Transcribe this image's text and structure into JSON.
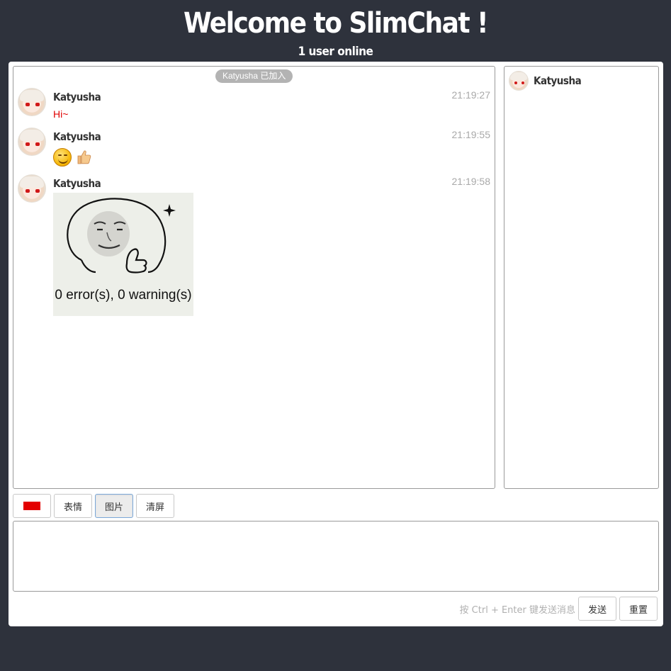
{
  "header": {
    "title": "Welcome to SlimChat !",
    "subtitle": "1 user online"
  },
  "chat": {
    "system_message": "Katyusha 已加入",
    "messages": [
      {
        "sender": "Katyusha",
        "time": "21:19:27",
        "type": "text",
        "text": "Hi~",
        "text_color": "#e00000"
      },
      {
        "sender": "Katyusha",
        "time": "21:19:55",
        "type": "emoji",
        "emojis": [
          "smile-emoji-icon",
          "thumbs-up-emoji-icon"
        ]
      },
      {
        "sender": "Katyusha",
        "time": "21:19:58",
        "type": "image",
        "image_caption": "0 error(s), 0 warning(s)"
      }
    ]
  },
  "users": {
    "online": [
      {
        "name": "Katyusha"
      }
    ]
  },
  "toolbar": {
    "color_value": "#e30000",
    "emoji_label": "表情",
    "image_label": "图片",
    "clear_label": "清屏"
  },
  "composer": {
    "value": "",
    "hint": "按 Ctrl + Enter 键发送消息",
    "send_label": "发送",
    "reset_label": "重置"
  },
  "colors": {
    "background": "#2e323c",
    "panel": "#ffffff",
    "message_text": "#e00000",
    "timestamp": "#a9a9a9"
  }
}
